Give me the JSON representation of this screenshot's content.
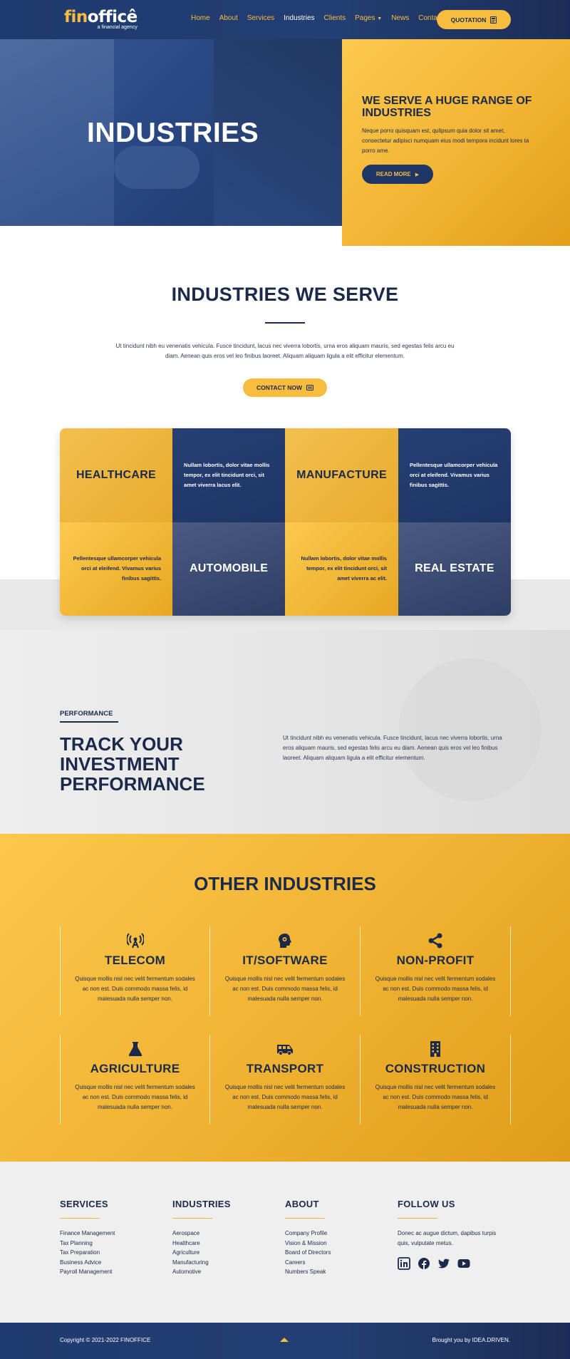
{
  "header": {
    "logo_fin": "fin",
    "logo_office": "officê",
    "logo_tagline": "a financial agency",
    "nav": [
      "Home",
      "About",
      "Services",
      "Industries",
      "Clients",
      "Pages",
      "News",
      "Contact"
    ],
    "active_nav": "Industries",
    "quote_label": "QUOTATION"
  },
  "hero": {
    "title": "INDUSTRIES",
    "card_title": "WE SERVE A HUGE RANGE OF INDUSTRIES",
    "card_text": "Neque porro quisquam est, qulipsum quia dolor sit amet, consectetur adipisci numquam eius modi tempora incidunt lores ta porro ame.",
    "read_more": "READ MORE"
  },
  "serve": {
    "title": "INDUSTRIES WE SERVE",
    "text": "Ut tincidunt nibh eu venenatis vehicula. Fusce tincidunt, lacus nec viverra lobortis, urna eros aliquam mauris, sed egestas felis arcu eu diam. Aenean quis eros vel leo finibus laoreet. Aliquam aliquam ligula a elit efficitur elementum.",
    "contact_label": "CONTACT NOW"
  },
  "grid": {
    "healthcare": "HEALTHCARE",
    "t1": "Nullam lobortis, dolor vitae mollis tempor, ex elit tincidunt orci, sit amet viverra lacus elit.",
    "manufacture": "MANUFACTURE",
    "t2": "Pellentesque ullamcorper vehicula orci at eleifend. Vivamus varius finibus sagittis.",
    "t3": "Pellentesque ullamcorper vehicula orci at eleifend. Vivamus varius finibus sagittis.",
    "automobile": "AUTOMOBILE",
    "t4": "Nullam lobortis, dolor vitae mollis tempor, ex elit tincidunt orci, sit amet viverra ac elit.",
    "real_estate": "REAL ESTATE"
  },
  "performance": {
    "label": "PERFORMANCE",
    "title": "TRACK YOUR INVESTMENT PERFORMANCE",
    "text": "Ut tincidunt nibh eu venenatis vehicula. Fusce tincidunt, lacus nec viverra lobortis, urna eros aliquam mauris, sed egestas felis arcu eu diam. Aenean quis eros vel leo finibus laoreet. Aliquam aliquam ligula a elit efficitur elementum."
  },
  "other": {
    "title": "OTHER INDUSTRIES",
    "items": [
      {
        "name": "TELECOM",
        "icon": "broadcast-tower-icon",
        "text": "Quisque mollis nisl nec velit fermentum sodales ac non est. Duis commodo massa felis, id malesuada nulla semper non."
      },
      {
        "name": "IT/SOFTWARE",
        "icon": "brain-gear-icon",
        "text": "Quisque mollis nisl nec velit fermentum sodales ac non est. Duis commodo massa felis, id malesuada nulla semper non."
      },
      {
        "name": "NON-PROFIT",
        "icon": "share-icon",
        "text": "Quisque mollis nisl nec velit fermentum sodales ac non est. Duis commodo massa felis, id malesuada nulla semper non."
      },
      {
        "name": "AGRICULTURE",
        "icon": "flask-icon",
        "text": "Quisque mollis nisl nec velit fermentum sodales ac non est. Duis commodo massa felis, id malesuada nulla semper non."
      },
      {
        "name": "TRANSPORT",
        "icon": "shuttle-van-icon",
        "text": "Quisque mollis nisl nec velit fermentum sodales ac non est. Duis commodo massa felis, id malesuada nulla semper non."
      },
      {
        "name": "CONSTRUCTION",
        "icon": "building-icon",
        "text": "Quisque mollis nisl nec velit fermentum sodales ac non est. Duis commodo massa felis, id malesuada nulla semper non."
      }
    ]
  },
  "footer": {
    "services_title": "SERVICES",
    "services": [
      "Finance Management",
      "Tax Planning",
      "Tax Preparation",
      "Business Advice",
      "Payroll Management"
    ],
    "industries_title": "INDUSTRIES",
    "industries": [
      "Aerospace",
      "Healthcare",
      "Agriculture",
      "Manufacturing",
      "Automotive"
    ],
    "about_title": "ABOUT",
    "about": [
      "Company Profile",
      "Vision & Mission",
      "Board of Directors",
      "Careers",
      "Numbers Speak"
    ],
    "follow_title": "FOLLOW US",
    "follow_text": "Donec ac augue dictum, dapibus turpis quis, vulputate metus.",
    "copyright": "Copyright © 2021-2022 FINOFFICE",
    "brought": "Brought you by IDEA.DRIVEN."
  },
  "colors": {
    "navy": "#1e3566",
    "yellow": "#f7bd3f",
    "light_gray": "#efefef"
  }
}
